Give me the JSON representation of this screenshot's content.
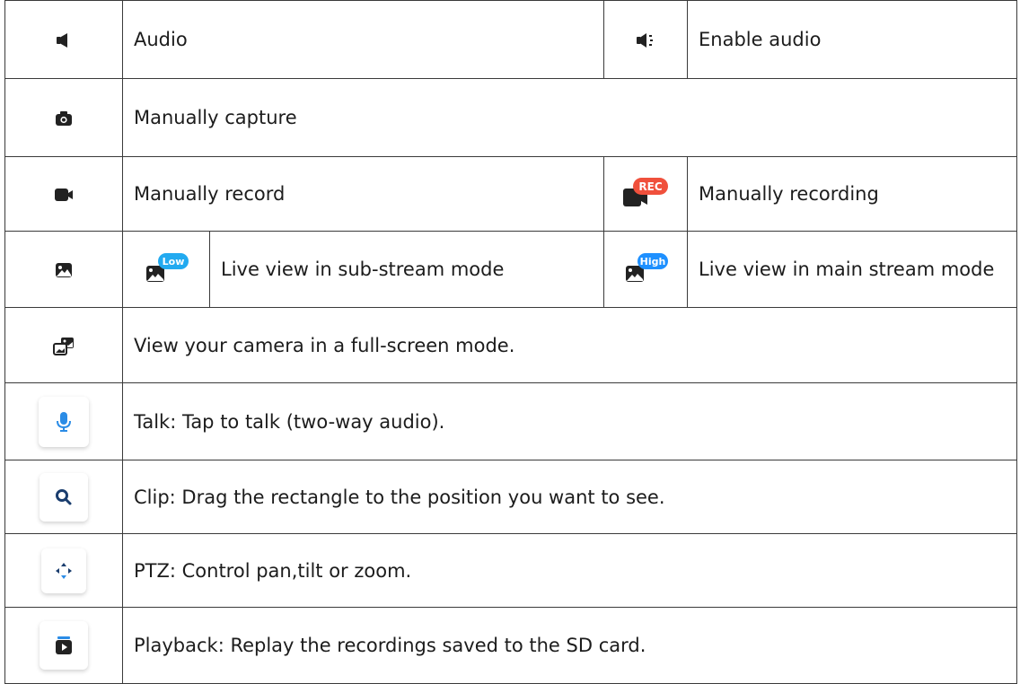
{
  "rows": [
    {
      "icon": "speaker-icon",
      "label": "Audio",
      "icon2": "speaker-on-icon",
      "label2": "Enable audio"
    },
    {
      "icon": "camera-icon",
      "label": "Manually capture"
    },
    {
      "icon": "video-camera-icon",
      "label": "Manually record",
      "icon2": "video-camera-recording-icon",
      "label2": "Manually recording",
      "badge2": "REC"
    },
    {
      "icon": "image-icon",
      "icon_b": "image-low-icon",
      "badge_b": "Low",
      "label": "Live view in sub-stream mode",
      "icon2": "image-high-icon",
      "badge2": "High",
      "label2": "Live view in main stream mode"
    },
    {
      "icon": "fullscreen-icon",
      "label": "View your camera in a full-screen mode."
    },
    {
      "icon": "microphone-icon",
      "label": "Talk: Tap to talk (two-way audio)."
    },
    {
      "icon": "magnifier-icon",
      "label": "Clip: Drag the rectangle to the position you want to see."
    },
    {
      "icon": "ptz-arrows-icon",
      "label": "PTZ: Control pan,tilt or zoom."
    },
    {
      "icon": "playback-icon",
      "label": "Playback: Replay the recordings saved to the SD card."
    }
  ],
  "colors": {
    "icon_dark": "#222222",
    "accent_blue": "#2b8ce6",
    "low_badge": "#22aaf0",
    "high_badge": "#1e90ff",
    "rec_badge": "#f0503c",
    "border": "#3a3a3a"
  }
}
